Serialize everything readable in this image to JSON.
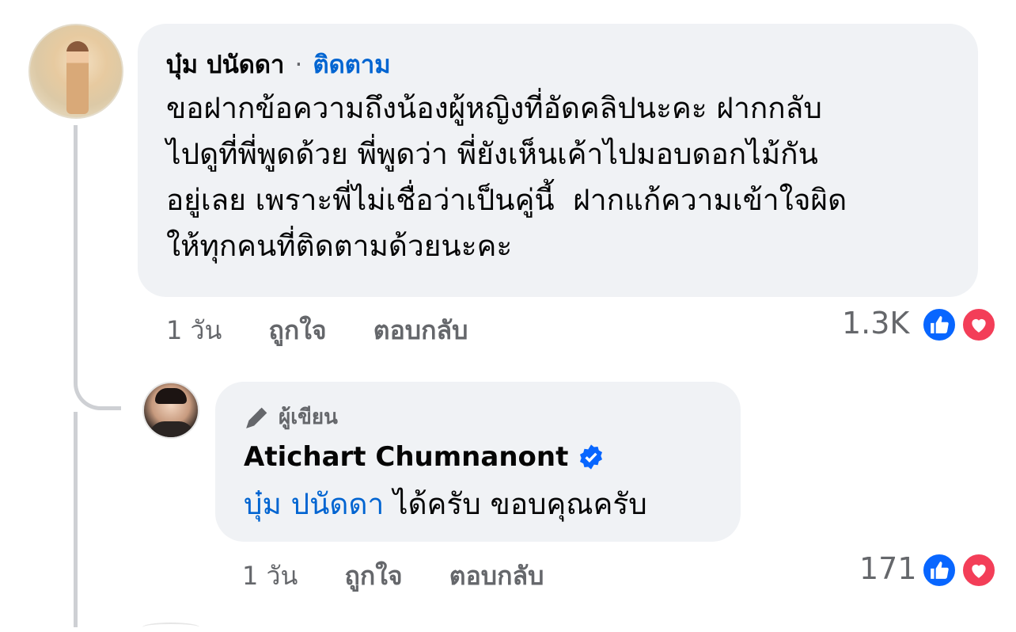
{
  "comment": {
    "author": "บุ๋ม ปนัดดา",
    "separator": "·",
    "follow_label": "ติดตาม",
    "text_lines": [
      "ขอฝากข้อความถึงน้องผู้หญิงที่อัดคลิปนะคะ ฝากกลับ",
      "ไปดูที่พี่พูดด้วย พี่พูดว่า พี่ยังเห็นเค้าไปมอบดอกไม้กัน",
      "อยู่เลย เพราะพี่ไม่เชื่อว่าเป็นคู่นี้  ฝากแก้ความเข้าใจผิด",
      "ให้ทุกคนที่ติดตามด้วยนะคะ"
    ],
    "time": "1 วัน",
    "like_label": "ถูกใจ",
    "reply_label": "ตอบกลับ",
    "reaction_count": "1.3K"
  },
  "reply": {
    "badge_label": "ผู้เขียน",
    "author": "Atichart Chumnanont",
    "mention": "บุ๋ม ปนัดดา",
    "text": " ได้ครับ ขอบคุณครับ",
    "time": "1 วัน",
    "like_label": "ถูกใจ",
    "reply_label": "ตอบกลับ",
    "reaction_count": "171"
  },
  "colors": {
    "link_blue": "#0064d1",
    "like_blue": "#0866ff",
    "love_red": "#f33e58",
    "bubble_bg": "#f0f2f5",
    "meta_gray": "#65676b"
  },
  "icons": [
    "like-icon",
    "love-icon",
    "verified-badge-icon",
    "pen-icon"
  ]
}
